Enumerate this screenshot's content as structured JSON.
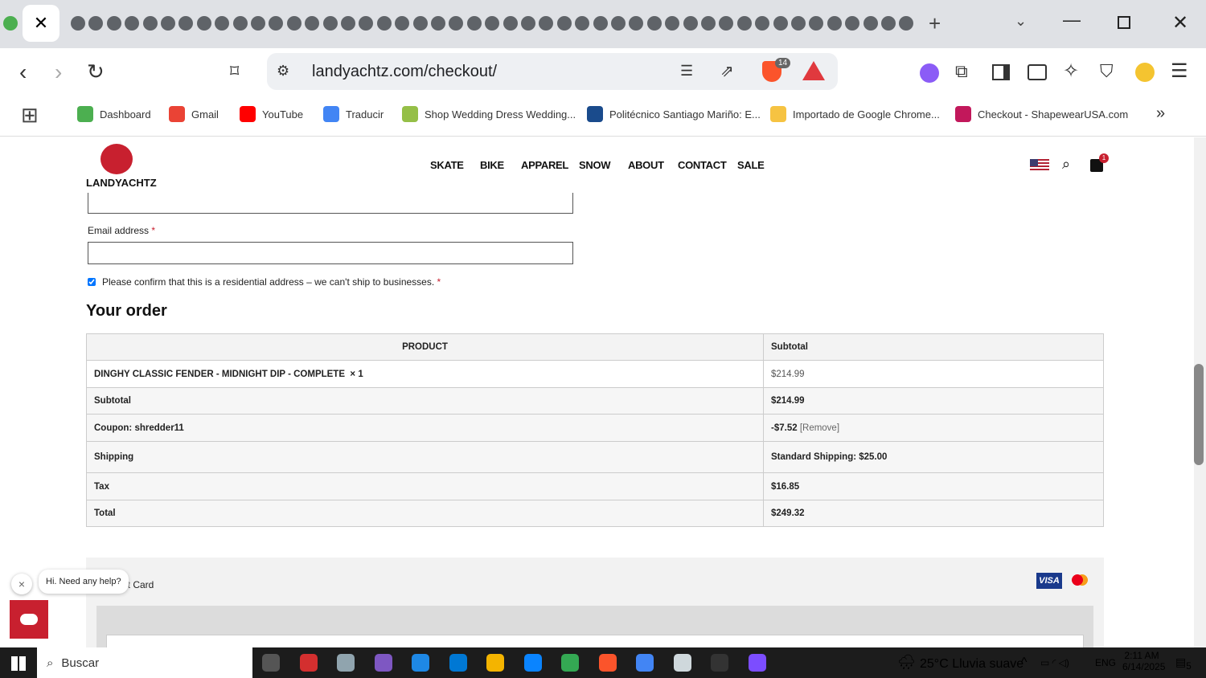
{
  "browser": {
    "url": "landyachtz.com/checkout/",
    "brave_badge": "14",
    "close_tab": "✕",
    "new_tab": "+"
  },
  "bookmarks": [
    {
      "label": "Dashboard",
      "color": "#4caf50"
    },
    {
      "label": "Gmail",
      "color": "#ea4335"
    },
    {
      "label": "YouTube",
      "color": "#ff0000"
    },
    {
      "label": "Traducir",
      "color": "#4285f4"
    },
    {
      "label": "Shop Wedding Dress Wedding...",
      "color": "#95bf47"
    },
    {
      "label": "Politécnico Santiago Mariño: E...",
      "color": "#1a4b8c"
    },
    {
      "label": "Importado de Google Chrome...",
      "color": "#f6c342"
    },
    {
      "label": "Checkout - ShapewearUSA.com",
      "color": "#c2185b"
    }
  ],
  "site": {
    "brand": "LANDYACHTZ",
    "nav": [
      "SKATE",
      "BIKE",
      "APPAREL",
      "SNOW",
      "ABOUT",
      "CONTACT",
      "SALE"
    ],
    "cart_count": "1",
    "accent": "#c8202f"
  },
  "form": {
    "email_label": "Email address",
    "required": "*",
    "email_value": "",
    "residential_label": "Please confirm that this is a residential address – we can't ship to businesses.",
    "residential_checked": true
  },
  "order": {
    "title": "Your order",
    "headers": [
      "PRODUCT",
      "Subtotal"
    ],
    "item": {
      "name": "DINGHY CLASSIC FENDER - MIDNIGHT DIP - COMPLETE",
      "qty": "× 1",
      "price": "$214.99"
    },
    "rows": [
      {
        "label": "Subtotal",
        "value": "$214.99"
      },
      {
        "label": "Coupon: shredder11",
        "value": "-$7.52",
        "extra": "[Remove]"
      },
      {
        "label": "Shipping",
        "value": "Standard Shipping: $25.00"
      },
      {
        "label": "Tax",
        "value": "$16.85"
      },
      {
        "label": "Total",
        "value": "$249.32"
      }
    ]
  },
  "payment": {
    "method": "Credit Card",
    "visa": "VISA"
  },
  "chat": {
    "bubble": "Hi. Need any help?",
    "close": "×"
  },
  "taskbar": {
    "search": "Buscar",
    "weather": "25°C  Lluvia suave",
    "lang": "ENG",
    "time": "2:11 AM",
    "date": "6/14/2025",
    "notif": "5"
  }
}
